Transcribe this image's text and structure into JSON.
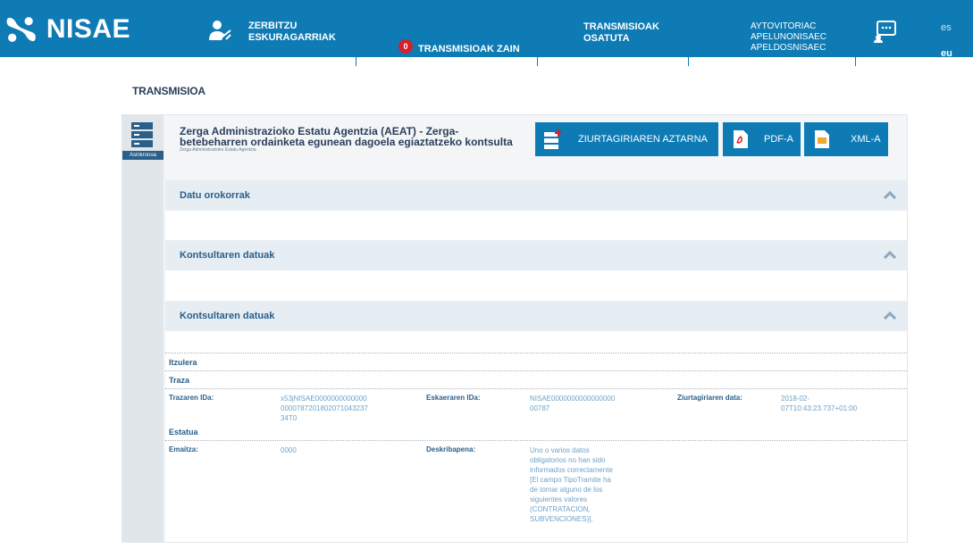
{
  "header": {
    "logo_text": "NISAE",
    "nav": {
      "services": "ZERBITZU ESKURAGARRIAK",
      "pending_count": "0",
      "pending": "TRANSMISIOAK ZAIN",
      "done": "TRANSMISIOAK OSATUTA",
      "user_line1": "AYTOVITORIAC",
      "user_line2": "APELUNONISAEC",
      "user_line3": "APELDOSNISAEC"
    },
    "lang_es": "es",
    "lang_eu": "eu",
    "colors": {
      "bar": "#0e7bb5",
      "badge": "#d5202a"
    }
  },
  "page": {
    "title": "TRANSMISIOA"
  },
  "request": {
    "type_badge": "Asinkronoa",
    "title": "Zerga Administrazioko Estatu Agentzia (AEAT) - Zerga-betebeharren ordainketa egunean dagoela egiaztatzeko kontsulta",
    "subtitle": "Zerga Administrazioko Estatu Agentzia"
  },
  "buttons": {
    "cert": "ZIURTAGIRIAREN AZTARNA",
    "pdf": "PDF-A",
    "xml": "XML-A"
  },
  "sections": {
    "general": "Datu orokorrak",
    "query1": "Kontsultaren datuak",
    "query2": "Kontsultaren datuak"
  },
  "detail": {
    "response_title": "Itzulera",
    "trace_title": "Traza",
    "trace_id_label": "Trazaren IDa:",
    "trace_id_value_l1": "x53jNISAE0000000000000",
    "trace_id_value_l2": "0000787201802071043237",
    "trace_id_value_l3": "34T0",
    "request_id_label": "Eskaeraren IDa:",
    "request_id_value_l1": "NISAE0000000000000000",
    "request_id_value_l2": "00787",
    "cert_date_label": "Ziurtagiriaren data:",
    "cert_date_value_l1": "2018-02-",
    "cert_date_value_l2": "07T10:43:23.737+01:00",
    "status_title": "Estatua",
    "result_label": "Emaitza:",
    "result_value": "0000",
    "description_label": "Deskribapena:",
    "description_lines": [
      "Uno o varios datos",
      "obligatorios no han sido",
      "informados correctamente",
      "[El campo TipoTramite ha",
      "de tomar alguno de los",
      "siguientes valores",
      "(CONTRATACION,",
      "SUBVENCIONES)]."
    ]
  }
}
